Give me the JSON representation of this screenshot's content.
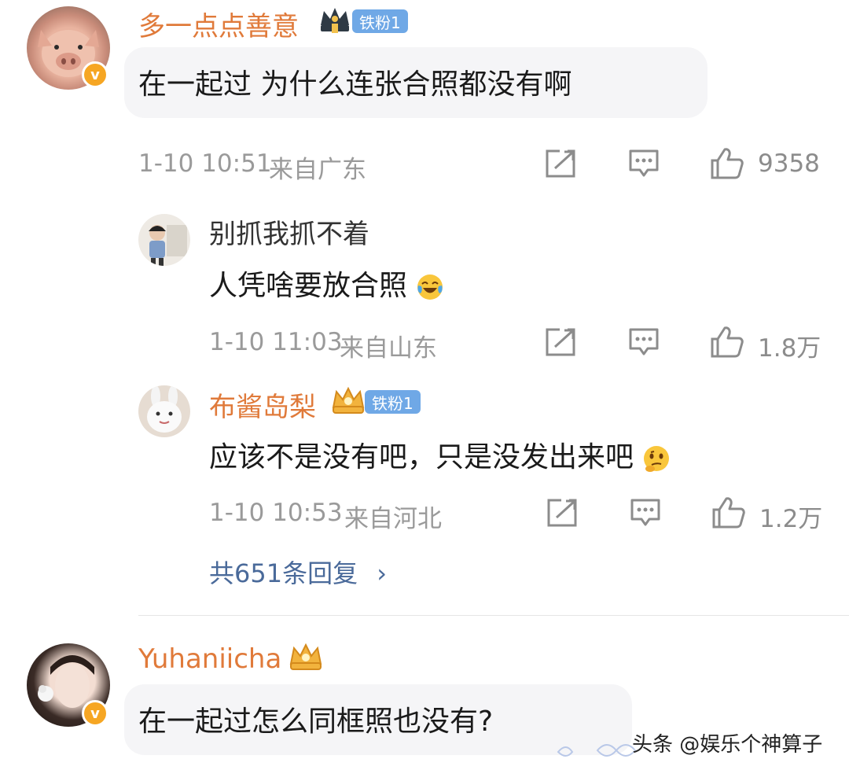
{
  "comments": [
    {
      "user": "多一点点善意",
      "fan_badge": "铁粉1",
      "text": "在一起过 为什么连张合照都没有啊",
      "time": "1-10 10:51",
      "location": "来自广东",
      "likes": "9358"
    },
    {
      "user": "Yuhaniicha",
      "text": "在一起过怎么同框照也没有?"
    }
  ],
  "replies": [
    {
      "user": "别抓我抓不着",
      "text": "人凭啥要放合照",
      "time": "1-10 11:03",
      "location": "来自山东",
      "likes": "1.8万"
    },
    {
      "user": "布酱岛梨",
      "fan_badge": "铁粉1",
      "text": "应该不是没有吧，只是没发出来吧",
      "time": "1-10 10:53",
      "location": "来自河北",
      "likes": "1.2万"
    }
  ],
  "more_replies": "共651条回复",
  "more_chevron": "›",
  "verified_mark": "v",
  "watermark": "头条 @娱乐个神算子",
  "colors": {
    "username": "#e07a3a",
    "fan_badge": "#6fa8e6",
    "verified": "#f6a623",
    "more_link": "#4a6a9a"
  },
  "icons": [
    "crown-icon",
    "share-icon",
    "comment-icon",
    "like-icon",
    "laugh-cry-emoji",
    "thinking-emoji",
    "chevron-right-icon"
  ]
}
